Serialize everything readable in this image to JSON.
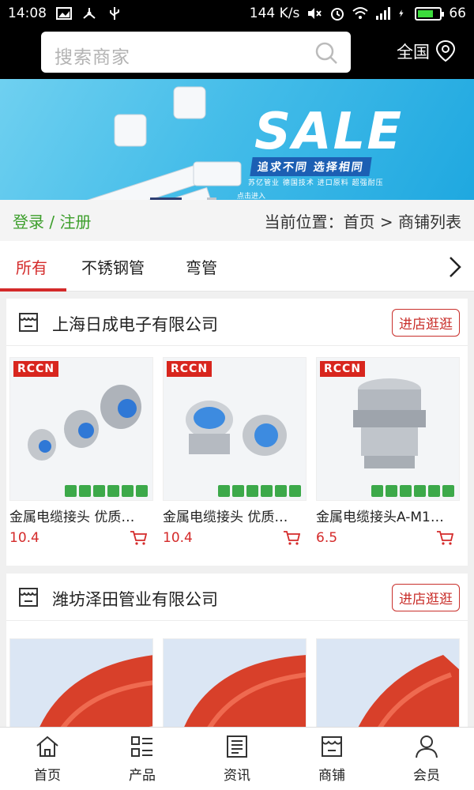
{
  "status_bar": {
    "time": "14:08",
    "speed": "144 K/s",
    "battery": "66",
    "network": "4G"
  },
  "header": {
    "search_placeholder": "搜索商家",
    "region": "全国"
  },
  "banner": {
    "headline": "SALE",
    "slogan": "追求不同  选择相同",
    "tags": "苏亿管业  德国技术  进口原料  超强耐压",
    "enter": "点击进入"
  },
  "breadcrumb": {
    "login": "登录 / 注册",
    "location": "当前位置：首页 > 商铺列表"
  },
  "tabs": [
    {
      "label": "所有",
      "active": true
    },
    {
      "label": "不锈钢管",
      "active": false
    },
    {
      "label": "弯管",
      "active": false
    }
  ],
  "shops": [
    {
      "name": "上海日成电子有限公司",
      "visit": "进店逛逛",
      "products": [
        {
          "name": "金属电缆接头 优质…",
          "price": "10.4",
          "logo": "RCCN"
        },
        {
          "name": "金属电缆接头 优质…",
          "price": "10.4",
          "logo": "RCCN"
        },
        {
          "name": "金属电缆接头A-M1…",
          "price": "6.5",
          "logo": "RCCN"
        }
      ]
    },
    {
      "name": "潍坊泽田管业有限公司",
      "visit": "进店逛逛",
      "products": [
        {
          "name": "",
          "price": "",
          "logo": ""
        },
        {
          "name": "",
          "price": "",
          "logo": ""
        },
        {
          "name": "",
          "price": "",
          "logo": ""
        }
      ]
    }
  ],
  "bottom_nav": [
    {
      "label": "首页",
      "icon": "home-icon"
    },
    {
      "label": "产品",
      "icon": "list-icon"
    },
    {
      "label": "资讯",
      "icon": "news-icon"
    },
    {
      "label": "商铺",
      "icon": "shop-icon"
    },
    {
      "label": "会员",
      "icon": "user-icon"
    }
  ],
  "colors": {
    "accent": "#d42a2a",
    "login_green": "#3c9e2b",
    "banner_blue": "#45bde9"
  }
}
